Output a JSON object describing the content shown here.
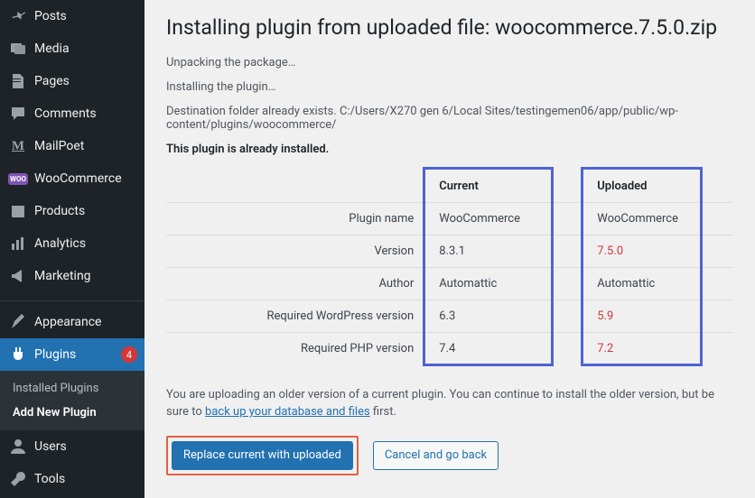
{
  "sidebar": {
    "items": [
      {
        "icon": "pin-icon",
        "label": "Posts"
      },
      {
        "icon": "media-icon",
        "label": "Media"
      },
      {
        "icon": "page-icon",
        "label": "Pages"
      },
      {
        "icon": "comments-icon",
        "label": "Comments"
      },
      {
        "icon": "mailpoet-icon",
        "label": "MailPoet"
      },
      {
        "icon": "woo-icon",
        "label": "WooCommerce"
      },
      {
        "icon": "products-icon",
        "label": "Products"
      },
      {
        "icon": "analytics-icon",
        "label": "Analytics"
      },
      {
        "icon": "marketing-icon",
        "label": "Marketing"
      },
      {
        "icon": "appearance-icon",
        "label": "Appearance"
      },
      {
        "icon": "plugins-icon",
        "label": "Plugins",
        "badge": "4"
      },
      {
        "icon": "users-icon",
        "label": "Users"
      },
      {
        "icon": "tools-icon",
        "label": "Tools"
      }
    ],
    "submenu": {
      "installed": "Installed Plugins",
      "add_new": "Add New Plugin"
    }
  },
  "main": {
    "title": "Installing plugin from uploaded file: woocommerce.7.5.0.zip",
    "status": {
      "unpacking": "Unpacking the package…",
      "installing": "Installing the plugin…",
      "destination": "Destination folder already exists. C:/Users/X270 gen 6/Local Sites/testingemen06/app/public/wp-content/plugins/woocommerce/",
      "already": "This plugin is already installed."
    },
    "compare": {
      "headers": {
        "current": "Current",
        "uploaded": "Uploaded"
      },
      "rows": [
        {
          "label": "Plugin name",
          "current": "WooCommerce",
          "uploaded": "WooCommerce",
          "warn": false
        },
        {
          "label": "Version",
          "current": "8.3.1",
          "uploaded": "7.5.0",
          "warn": true
        },
        {
          "label": "Author",
          "current": "Automattic",
          "uploaded": "Automattic",
          "warn": false
        },
        {
          "label": "Required WordPress version",
          "current": "6.3",
          "uploaded": "5.9",
          "warn": true
        },
        {
          "label": "Required PHP version",
          "current": "7.4",
          "uploaded": "7.2",
          "warn": true
        }
      ]
    },
    "notice": {
      "pre": "You are uploading an older version of a current plugin. You can continue to install the older version, but be sure to ",
      "link": "back up your database and files",
      "post": " first."
    },
    "buttons": {
      "replace": "Replace current with uploaded",
      "cancel": "Cancel and go back"
    }
  }
}
